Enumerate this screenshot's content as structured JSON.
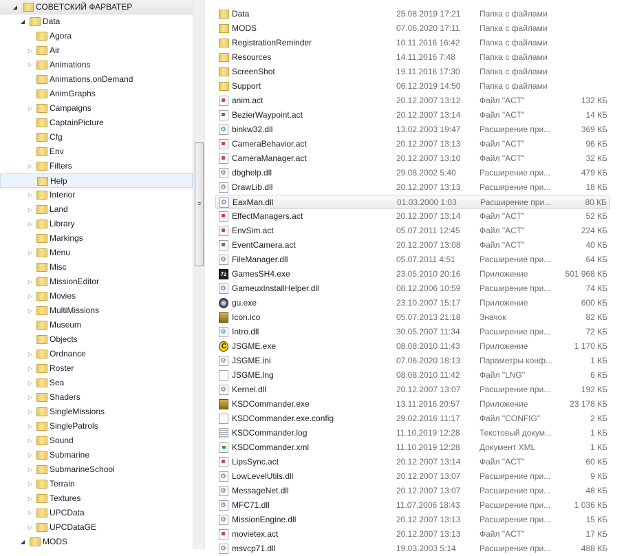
{
  "tree": {
    "root": {
      "label": "СОВЕТСКИЙ ФАРВАТЕР",
      "expanded": true
    },
    "data": {
      "label": "Data",
      "expanded": true
    },
    "children": [
      {
        "label": "Agora",
        "has_children": false
      },
      {
        "label": "Air",
        "has_children": true
      },
      {
        "label": "Animations",
        "has_children": true
      },
      {
        "label": "Animations.onDemand",
        "has_children": false
      },
      {
        "label": "AnimGraphs",
        "has_children": false
      },
      {
        "label": "Campaigns",
        "has_children": true
      },
      {
        "label": "CaptainPicture",
        "has_children": false
      },
      {
        "label": "Cfg",
        "has_children": false
      },
      {
        "label": "Env",
        "has_children": false
      },
      {
        "label": "Filters",
        "has_children": true
      },
      {
        "label": "Help",
        "has_children": false,
        "selected": true
      },
      {
        "label": "Interior",
        "has_children": true
      },
      {
        "label": "Land",
        "has_children": true
      },
      {
        "label": "Library",
        "has_children": true
      },
      {
        "label": "Markings",
        "has_children": false
      },
      {
        "label": "Menu",
        "has_children": true
      },
      {
        "label": "Misc",
        "has_children": false
      },
      {
        "label": "MissionEditor",
        "has_children": true
      },
      {
        "label": "Movies",
        "has_children": true
      },
      {
        "label": "MultiMissions",
        "has_children": true
      },
      {
        "label": "Museum",
        "has_children": false
      },
      {
        "label": "Objects",
        "has_children": false
      },
      {
        "label": "Ordnance",
        "has_children": true
      },
      {
        "label": "Roster",
        "has_children": true
      },
      {
        "label": "Sea",
        "has_children": true
      },
      {
        "label": "Shaders",
        "has_children": true
      },
      {
        "label": "SingleMissions",
        "has_children": true
      },
      {
        "label": "SinglePatrols",
        "has_children": true
      },
      {
        "label": "Sound",
        "has_children": true
      },
      {
        "label": "Submarine",
        "has_children": true
      },
      {
        "label": "SubmarineSchool",
        "has_children": true
      },
      {
        "label": "Terrain",
        "has_children": true
      },
      {
        "label": "Textures",
        "has_children": true
      },
      {
        "label": "UPCData",
        "has_children": true
      },
      {
        "label": "UPCDataGE",
        "has_children": true
      }
    ],
    "mods": {
      "label": "MODS",
      "expanded": true
    }
  },
  "files": [
    {
      "name": "Data",
      "date": "25.08.2019 17:21",
      "type": "Папка с файлами",
      "size": "",
      "icon": "folder"
    },
    {
      "name": "MODS",
      "date": "07.06.2020 17:11",
      "type": "Папка с файлами",
      "size": "",
      "icon": "folder"
    },
    {
      "name": "RegistrationReminder",
      "date": "10.11.2016 16:42",
      "type": "Папка с файлами",
      "size": "",
      "icon": "folder"
    },
    {
      "name": "Resources",
      "date": "14.11.2016 7:48",
      "type": "Папка с файлами",
      "size": "",
      "icon": "folder"
    },
    {
      "name": "ScreenShot",
      "date": "19.11.2016 17:30",
      "type": "Папка с файлами",
      "size": "",
      "icon": "folder"
    },
    {
      "name": "Support",
      "date": "06.12.2019 14:50",
      "type": "Папка с файлами",
      "size": "",
      "icon": "folder"
    },
    {
      "name": "anim.act",
      "date": "20.12.2007 13:12",
      "type": "Файл \"ACT\"",
      "size": "132 КБ",
      "icon": "act"
    },
    {
      "name": "BezierWaypoint.act",
      "date": "20.12.2007 13:14",
      "type": "Файл \"ACT\"",
      "size": "14 КБ",
      "icon": "act"
    },
    {
      "name": "binkw32.dll",
      "date": "13.02.2003 19:47",
      "type": "Расширение при...",
      "size": "369 КБ",
      "icon": "dll"
    },
    {
      "name": "CameraBehavior.act",
      "date": "20.12.2007 13:13",
      "type": "Файл \"ACT\"",
      "size": "96 КБ",
      "icon": "act"
    },
    {
      "name": "CameraManager.act",
      "date": "20.12.2007 13:10",
      "type": "Файл \"ACT\"",
      "size": "32 КБ",
      "icon": "act"
    },
    {
      "name": "dbghelp.dll",
      "date": "29.08.2002 5:40",
      "type": "Расширение при...",
      "size": "479 КБ",
      "icon": "dll"
    },
    {
      "name": "DrawLib.dll",
      "date": "20.12.2007 13:13",
      "type": "Расширение при...",
      "size": "18 КБ",
      "icon": "dll"
    },
    {
      "name": "EaxMan.dll",
      "date": "01.03.2000 1:03",
      "type": "Расширение при...",
      "size": "80 КБ",
      "icon": "dll",
      "hovered": true
    },
    {
      "name": "EffectManagers.act",
      "date": "20.12.2007 13:14",
      "type": "Файл \"ACT\"",
      "size": "52 КБ",
      "icon": "act"
    },
    {
      "name": "EnvSim.act",
      "date": "05.07.2011 12:45",
      "type": "Файл \"ACT\"",
      "size": "224 КБ",
      "icon": "act"
    },
    {
      "name": "EventCamera.act",
      "date": "20.12.2007 13:08",
      "type": "Файл \"ACT\"",
      "size": "40 КБ",
      "icon": "act"
    },
    {
      "name": "FileManager.dll",
      "date": "05.07.2011 4:51",
      "type": "Расширение при...",
      "size": "64 КБ",
      "icon": "dll"
    },
    {
      "name": "GamesSH4.exe",
      "date": "23.05.2010 20:16",
      "type": "Приложение",
      "size": "501 968 КБ",
      "icon": "7z"
    },
    {
      "name": "GameuxInstallHelper.dll",
      "date": "08.12.2006 10:59",
      "type": "Расширение при...",
      "size": "74 КБ",
      "icon": "dll"
    },
    {
      "name": "gu.exe",
      "date": "23.10.2007 15:17",
      "type": "Приложение",
      "size": "600 КБ",
      "icon": "gu"
    },
    {
      "name": "Icon.ico",
      "date": "05.07.2013 21:18",
      "type": "Значок",
      "size": "82 КБ",
      "icon": "ksd"
    },
    {
      "name": "Intro.dll",
      "date": "30.05.2007 11:34",
      "type": "Расширение при...",
      "size": "72 КБ",
      "icon": "dll"
    },
    {
      "name": "JSGME.exe",
      "date": "08.08.2010 11:43",
      "type": "Приложение",
      "size": "1 170 КБ",
      "icon": "jsgme"
    },
    {
      "name": "JSGME.ini",
      "date": "07.06.2020 18:13",
      "type": "Параметры конф...",
      "size": "1 КБ",
      "icon": "ini"
    },
    {
      "name": "JSGME.lng",
      "date": "08.08.2010 11:42",
      "type": "Файл \"LNG\"",
      "size": "6 КБ",
      "icon": "blank"
    },
    {
      "name": "Kernel.dll",
      "date": "20.12.2007 13:07",
      "type": "Расширение при...",
      "size": "192 КБ",
      "icon": "dll"
    },
    {
      "name": "KSDCommander.exe",
      "date": "13.11.2016 20:57",
      "type": "Приложение",
      "size": "23 178 КБ",
      "icon": "ksd"
    },
    {
      "name": "KSDCommander.exe.config",
      "date": "29.02.2016 11:17",
      "type": "Файл \"CONFIG\"",
      "size": "2 КБ",
      "icon": "blank"
    },
    {
      "name": "KSDCommander.log",
      "date": "11.10.2019 12:28",
      "type": "Текстовый докум...",
      "size": "1 КБ",
      "icon": "txt"
    },
    {
      "name": "KSDCommander.xml",
      "date": "11.10.2019 12:28",
      "type": "Документ XML",
      "size": "1 КБ",
      "icon": "xml"
    },
    {
      "name": "LipsSync.act",
      "date": "20.12.2007 13:14",
      "type": "Файл \"ACT\"",
      "size": "60 КБ",
      "icon": "act"
    },
    {
      "name": "LowLevelUtils.dll",
      "date": "20.12.2007 13:07",
      "type": "Расширение при...",
      "size": "9 КБ",
      "icon": "dll"
    },
    {
      "name": "MessageNet.dll",
      "date": "20.12.2007 13:07",
      "type": "Расширение при...",
      "size": "48 КБ",
      "icon": "dll"
    },
    {
      "name": "MFC71.dll",
      "date": "11.07.2006 18:43",
      "type": "Расширение при...",
      "size": "1 036 КБ",
      "icon": "dll"
    },
    {
      "name": "MissionEngine.dll",
      "date": "20.12.2007 13:13",
      "type": "Расширение при...",
      "size": "15 КБ",
      "icon": "dll"
    },
    {
      "name": "movietex.act",
      "date": "20.12.2007 13:13",
      "type": "Файл \"ACT\"",
      "size": "17 КБ",
      "icon": "act"
    },
    {
      "name": "msvcp71.dll",
      "date": "19.03.2003 5:14",
      "type": "Расширение при...",
      "size": "488 КБ",
      "icon": "dll"
    }
  ]
}
